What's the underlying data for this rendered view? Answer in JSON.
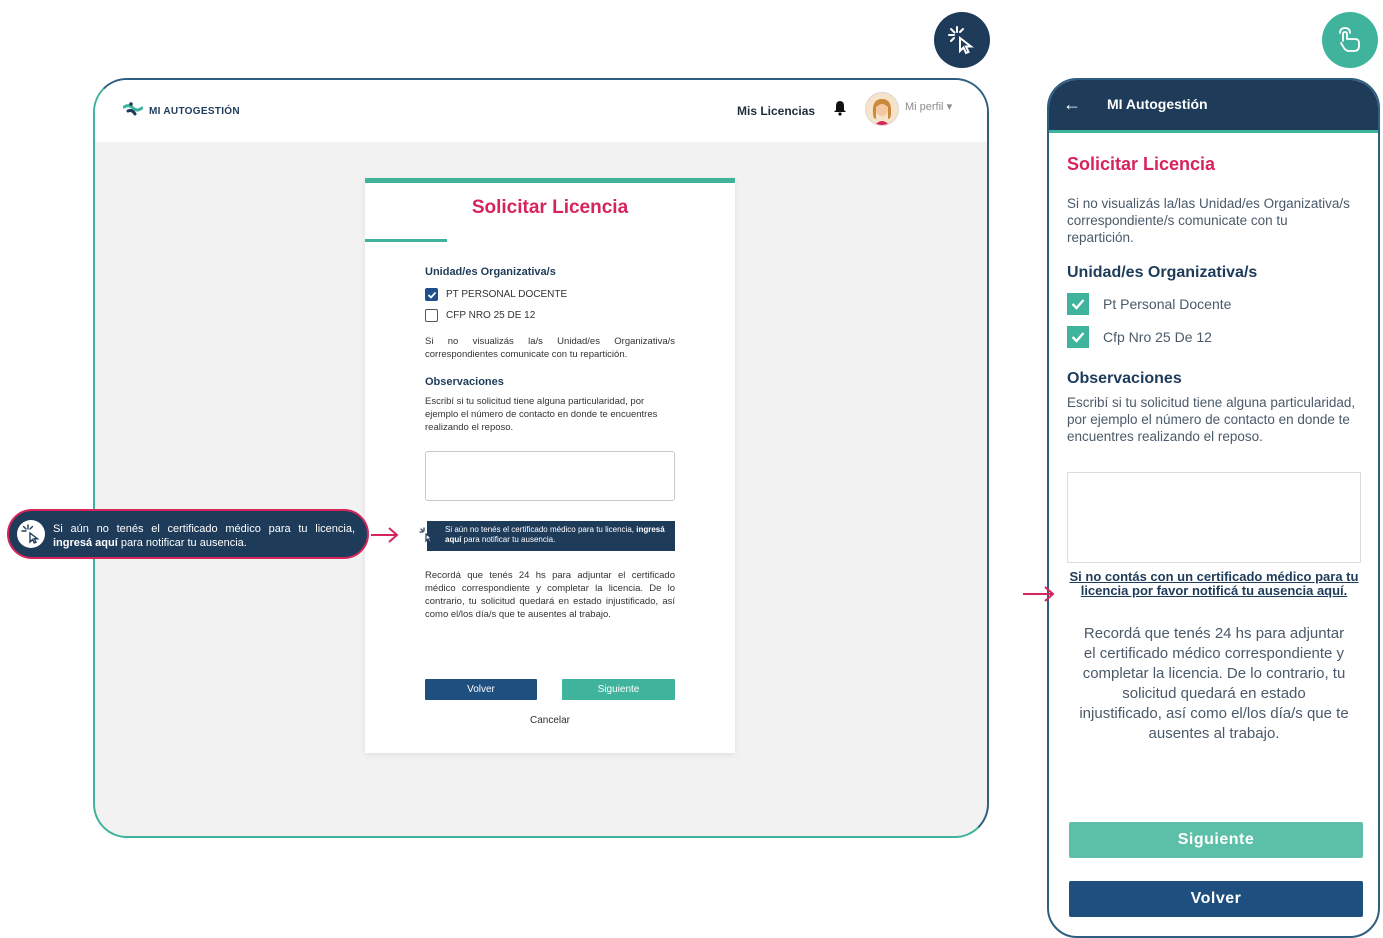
{
  "colors": {
    "brand_navy": "#1e3b5a",
    "accent_teal": "#3fb39b",
    "accent_pink": "#d7245a",
    "button_blue": "#1e4f7e"
  },
  "top_icons": {
    "desktop": "cursor-click-icon",
    "mobile": "tap-hand-icon"
  },
  "desktop": {
    "brand": "MI AUTOGESTIÓN",
    "nav": {
      "licenses": "Mis Licencias",
      "profile": "Mi perfil"
    },
    "card": {
      "title": "Solicitar Licencia",
      "units_heading": "Unidad/es Organizativa/s",
      "units": [
        {
          "label": "PT PERSONAL DOCENTE",
          "checked": true
        },
        {
          "label": "CFP NRO 25 DE 12",
          "checked": false
        }
      ],
      "units_note": "Si no visualizás la/s Unidad/es Organizativa/s correspondientes comunicate con tu repartición.",
      "observations_heading": "Observaciones",
      "observations_help": "Escribí si tu solicitud tiene alguna particularidad, por ejemplo el número de contacto en donde te encuentres realizando el reposo.",
      "notice_prefix": "Si aún no tenés el certificado médico para tu licencia, ",
      "notice_link": "ingresá aquí",
      "notice_suffix": " para notificar tu ausencia.",
      "reminder": "Recordá que tenés 24 hs para adjuntar el certificado médico correspondiente y completar la licencia. De lo contrario, tu solicitud quedará en estado injustificado, así como el/los día/s que te ausentes al trabajo.",
      "back_button": "Volver",
      "next_button": "Siguiente",
      "cancel_link": "Cancelar"
    },
    "callout": {
      "prefix": "Si aún no tenés el certificado médico para tu licencia, ",
      "link": "ingresá aquí",
      "suffix": " para notificar tu ausencia."
    }
  },
  "mobile": {
    "header_title": "MI Autogestión",
    "title": "Solicitar Licencia",
    "units_note": "Si no visualizás la/las Unidad/es Organizativa/s correspondiente/s comunicate con tu repartición.",
    "units_heading": "Unidad/es Organizativa/s",
    "units": [
      {
        "label": "Pt Personal Docente",
        "checked": true
      },
      {
        "label": "Cfp Nro 25 De 12",
        "checked": true
      }
    ],
    "observations_heading": "Observaciones",
    "observations_help": "Escribí si tu solicitud tiene alguna particularidad, por ejemplo el número de contacto en donde te encuentres realizando el reposo.",
    "notify_link": "Si no contás con un certificado médico para tu licencia por favor notificá tu ausencia aquí.",
    "reminder": "Recordá que tenés 24 hs para adjuntar el certificado médico correspondiente y completar la licencia. De lo contrario, tu solicitud quedará en estado injustificado, así como el/los día/s que te ausentes al trabajo.",
    "next_button": "Siguiente",
    "back_button": "Volver"
  }
}
